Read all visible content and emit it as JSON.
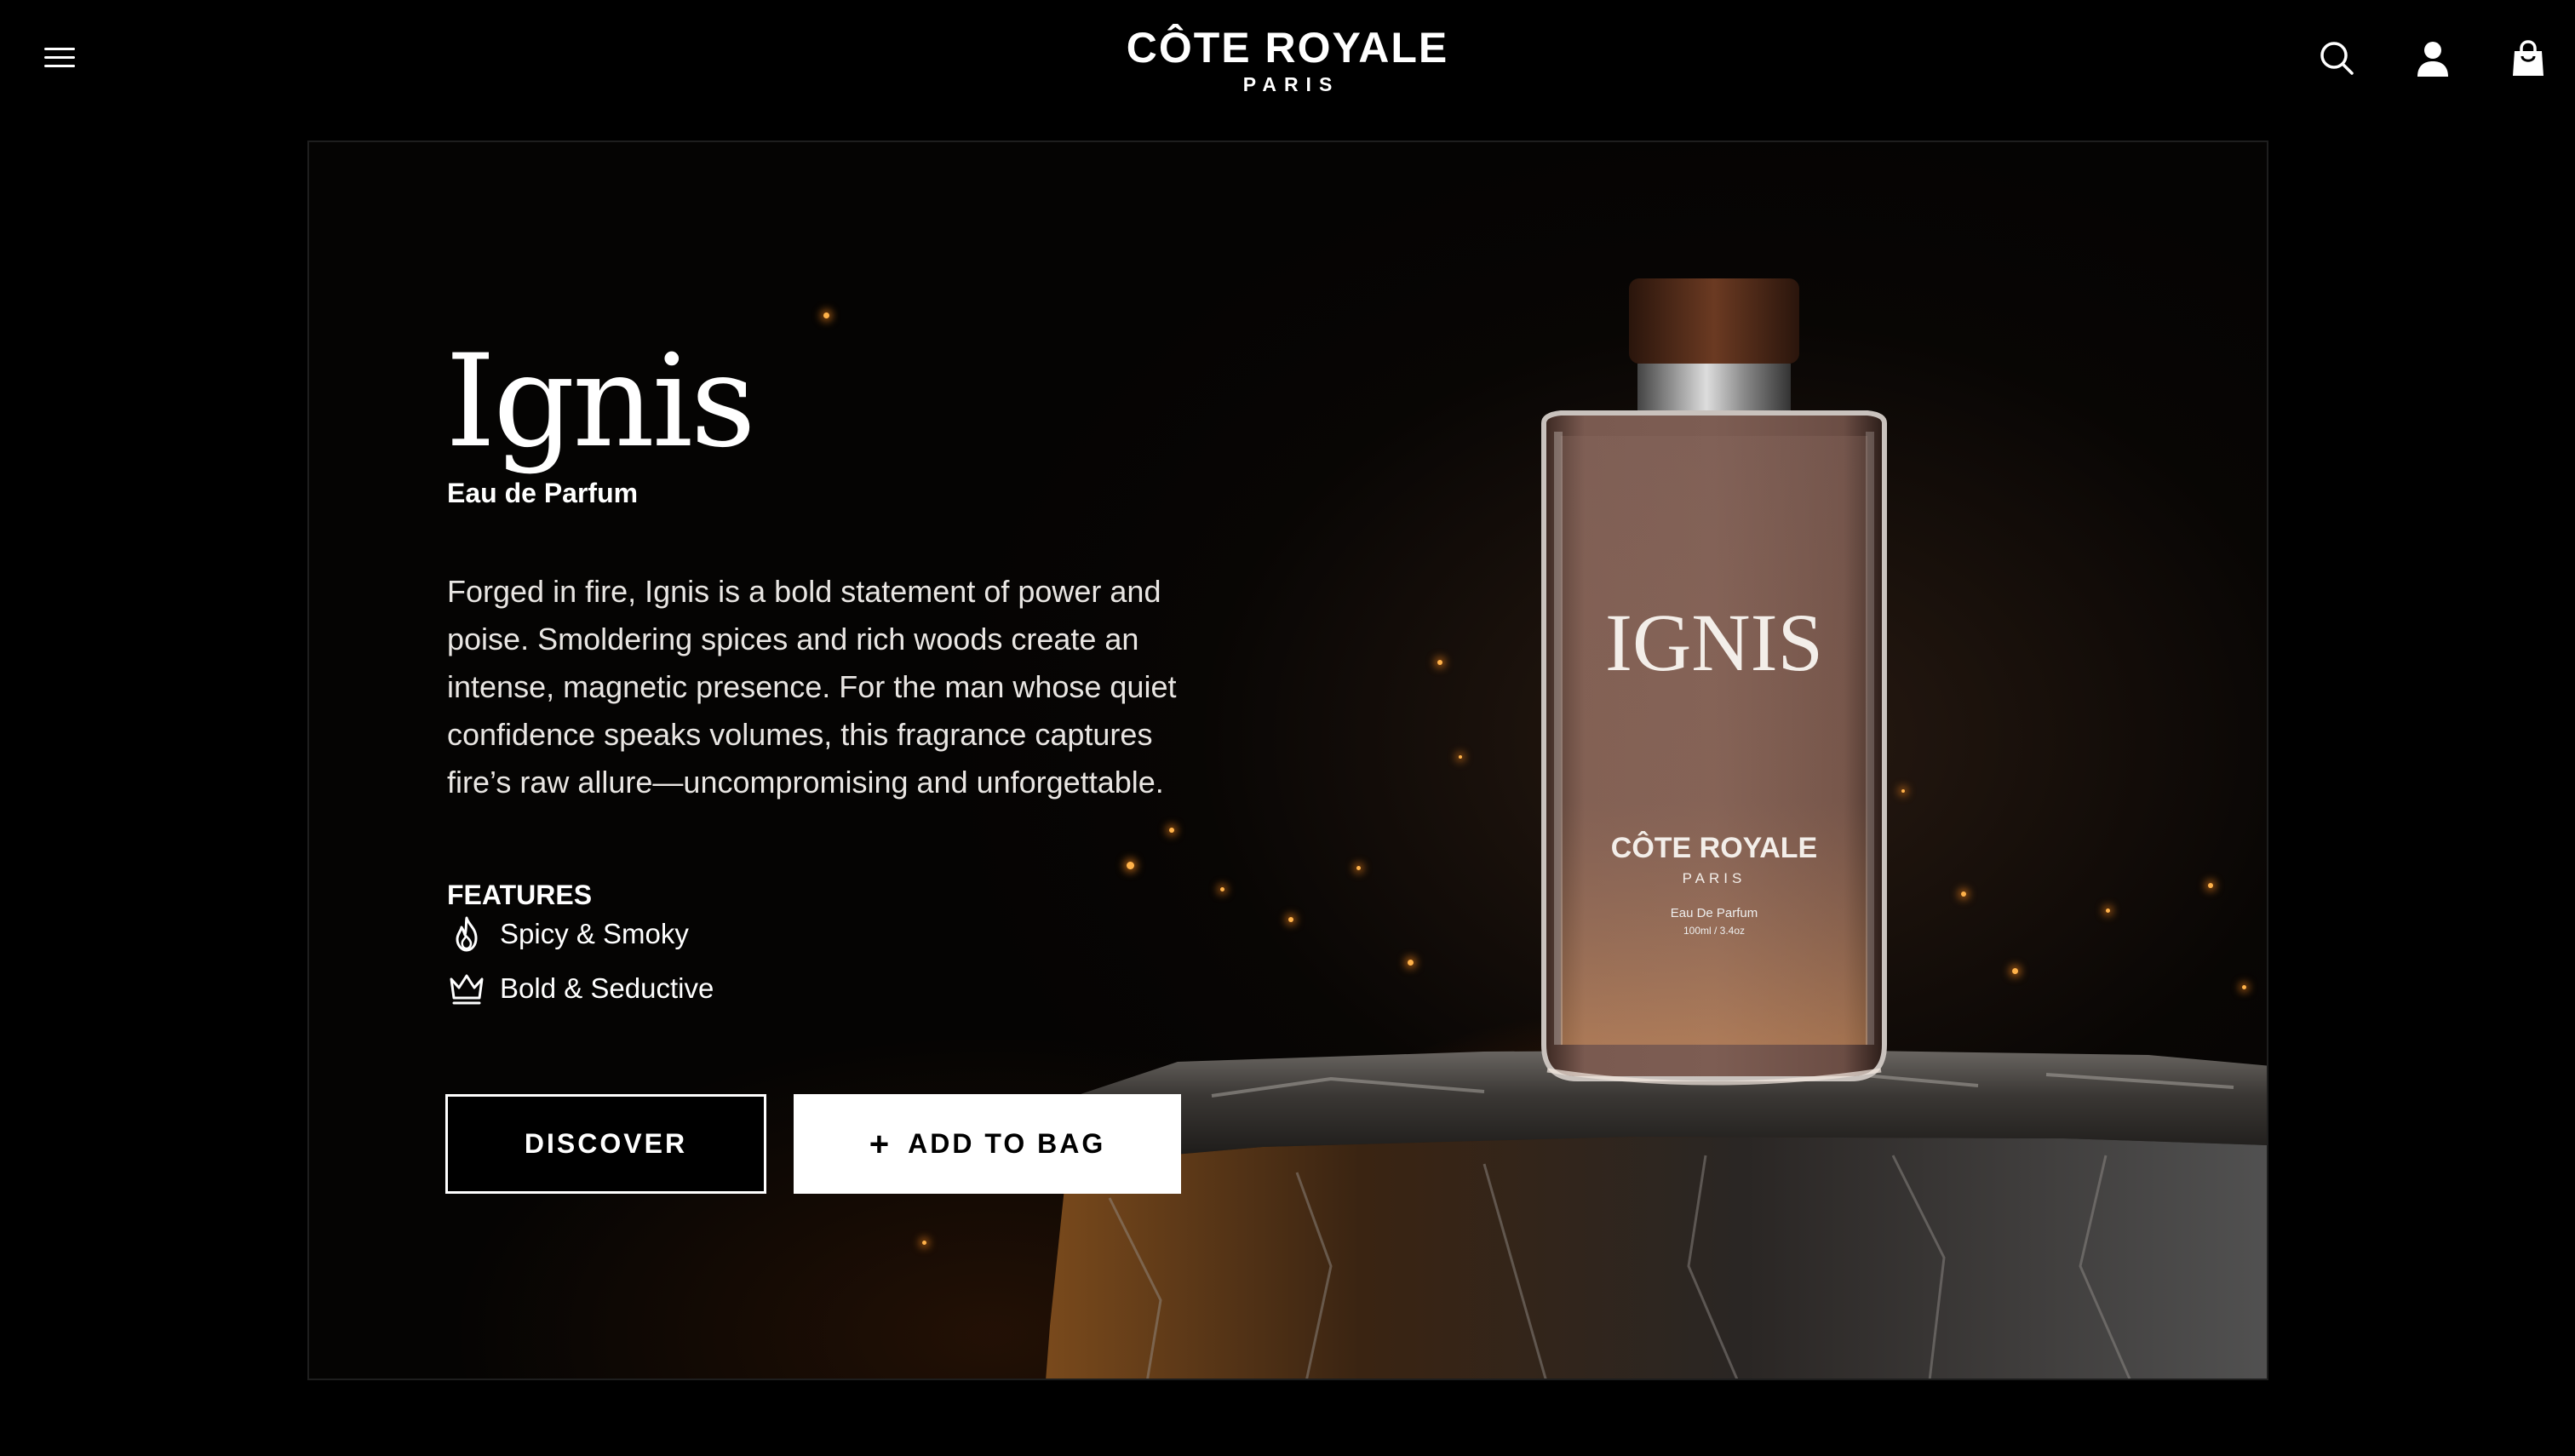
{
  "brand": {
    "name": "CÔTE ROYALE",
    "city": "PARIS"
  },
  "header": {
    "icons": [
      "menu-icon",
      "search-icon",
      "account-icon",
      "shopping-bag-icon"
    ]
  },
  "product": {
    "name": "Ignis",
    "type": "Eau de Parfum",
    "description": "Forged in fire, Ignis is a bold statement of power and poise. Smoldering spices and rich woods create an intense, magnetic presence. For the man whose quiet confidence speaks volumes, this fragrance captures fire’s raw allure—uncompromising and unforgettable.",
    "bottle_label": {
      "name": "IGNIS",
      "brand": "CÔTE ROYALE",
      "city": "PARIS",
      "type": "Eau De Parfum",
      "volume": "100ml / 3.4oz"
    }
  },
  "features": {
    "heading": "FEATURES",
    "items": [
      {
        "icon": "flame-icon",
        "label": "Spicy & Smoky"
      },
      {
        "icon": "crown-icon",
        "label": "Bold & Seductive"
      }
    ]
  },
  "actions": {
    "discover_label": "DISCOVER",
    "add_to_bag_label": "ADD TO BAG",
    "add_icon": "plus-icon"
  },
  "colors": {
    "background": "#000000",
    "text": "#ffffff",
    "bottle_liquid": "#7a5a50",
    "fire_glow": "#ff9a2a"
  }
}
